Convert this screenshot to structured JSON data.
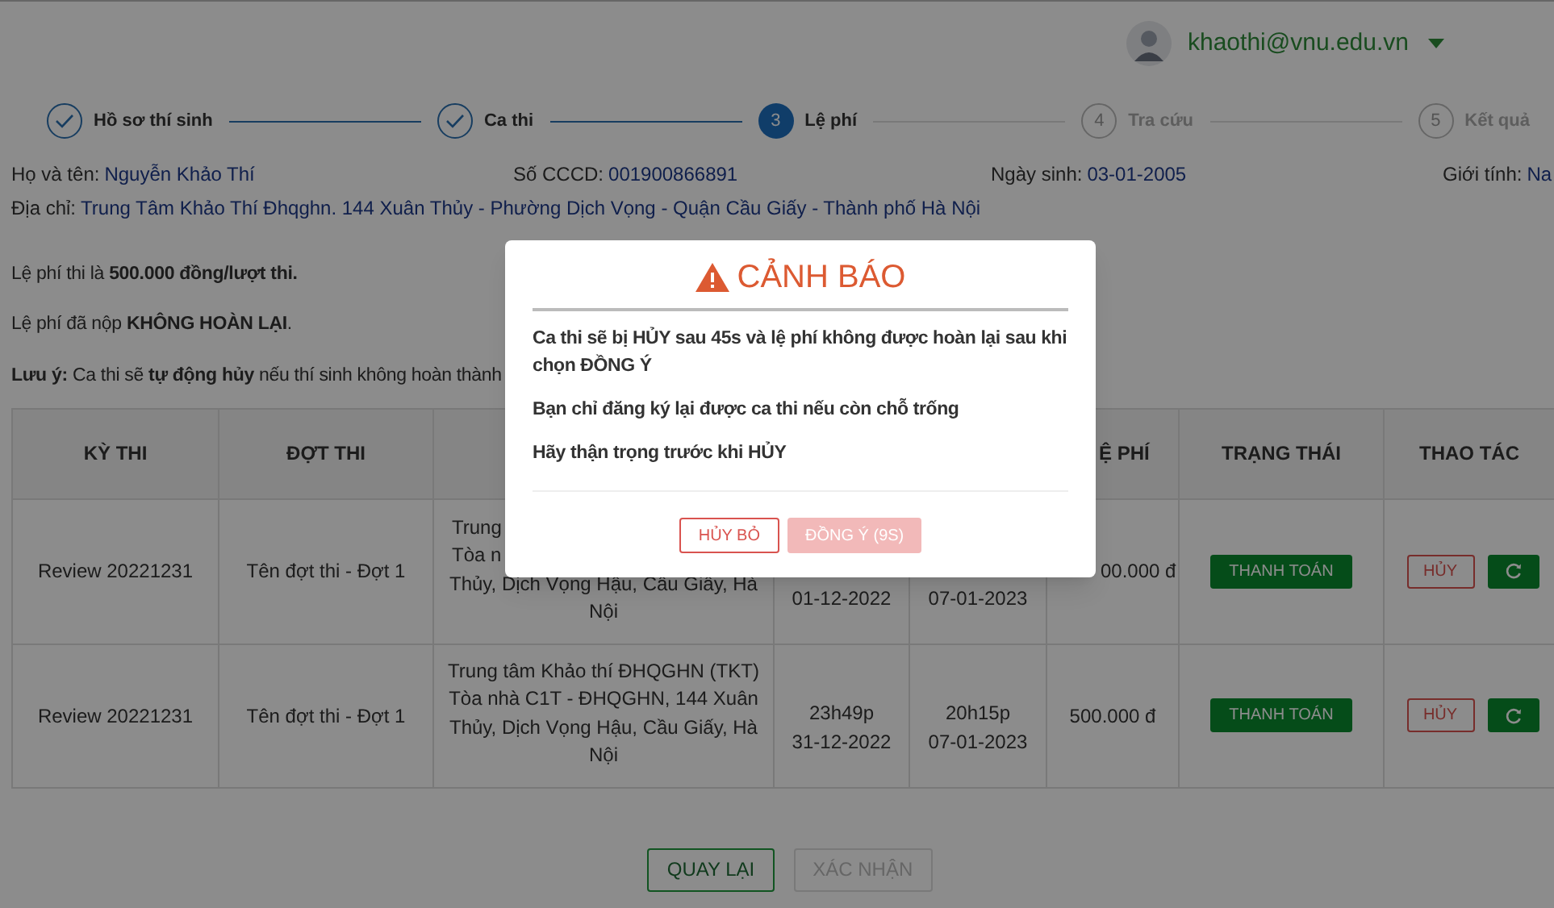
{
  "user": {
    "email": "khaothi@vnu.edu.vn"
  },
  "steps": [
    {
      "label": "Hồ sơ thí sinh",
      "completed": true,
      "selected": false
    },
    {
      "label": "Ca thi",
      "completed": true,
      "selected": false
    },
    {
      "number": "3",
      "label": "Lệ phí",
      "completed": false,
      "selected": true
    },
    {
      "number": "4",
      "label": "Tra cứu",
      "completed": false,
      "selected": false
    },
    {
      "number": "5",
      "label": "Kết quả",
      "completed": false,
      "selected": false
    }
  ],
  "candidate": [
    {
      "label": "Họ và tên:",
      "value": "Nguyễn Khảo Thí"
    },
    {
      "label": "Số CCCD:",
      "value": "001900866891"
    },
    {
      "label": "Ngày sinh:",
      "value": "03-01-2005"
    },
    {
      "label": "Giới tính:",
      "value": "Na"
    }
  ],
  "address": {
    "label": "Địa chỉ:",
    "value": "Trung Tâm Khảo Thí Đhqghn. 144 Xuân Thủy - Phường Dịch Vọng - Quận Cầu Giấy - Thành phố Hà Nội"
  },
  "notes": [
    "Lệ phí thi là **500.000 đồng/lượt thi.**",
    "Lệ phí đã nộp **KHÔNG HOÀN LẠI**.",
    "**Lưu ý:** Ca thi sẽ **tự động hủy** nếu thí sinh không hoàn thành"
  ],
  "table": {
    "columns": [
      {
        "label": "KỲ THI"
      },
      {
        "label": "ĐỢT THI"
      },
      null,
      null,
      null,
      {
        "label": "Ệ PHÍ",
        "cut": true
      },
      {
        "label": "TRẠNG THÁI"
      },
      {
        "label": "THAO TÁC"
      }
    ],
    "rows": [
      {
        "exam": "Review 20221231",
        "round": "Tên đợt thi - Đợt 1",
        "location": [
          {
            "text": "Trung",
            "cut": true
          },
          {
            "text": "Tòa n",
            "cut": true
          },
          {
            "text": "Thủy, Dịch Vọng Hậu, Cầu Giấy, Hà",
            "cut": false
          },
          {
            "text": "Nội",
            "cut": false
          }
        ],
        "start": [
          "01-12-2022"
        ],
        "end": [
          "07-01-2023"
        ],
        "fee": {
          "text": "00.000 đ",
          "cut": true
        },
        "status": "THANH TOÁN",
        "cancel": "HỦY"
      },
      {
        "exam": "Review 20221231",
        "round": "Tên đợt thi - Đợt 1",
        "location": [
          {
            "text": "Trung tâm Khảo thí ĐHQGHN (TKT)",
            "cut": false
          },
          {
            "text": "Tòa nhà C1T - ĐHQGHN, 144 Xuân",
            "cut": false
          },
          {
            "text": "Thủy, Dịch Vọng Hậu, Cầu Giấy, Hà",
            "cut": false
          },
          {
            "text": "Nội",
            "cut": false
          }
        ],
        "start": [
          "23h49p",
          "31-12-2022"
        ],
        "end": [
          "20h15p",
          "07-01-2023"
        ],
        "fee": {
          "text": "500.000 đ",
          "cut": false
        },
        "status": "THANH TOÁN",
        "cancel": "HỦY"
      }
    ]
  },
  "footer_buttons": [
    {
      "label": "QUAY LẠI",
      "disabled": false
    },
    {
      "label": "XÁC NHẬN",
      "disabled": true
    }
  ],
  "dialog": {
    "title": "CẢNH BÁO",
    "paragraphs": [
      "Ca thi sẽ bị HỦY sau 45s và lệ phí không được hoàn lại sau khi chọn ĐỒNG Ý",
      "Bạn chỉ đăng ký lại được ca thi nếu còn chỗ trống",
      "Hãy thận trọng trước khi HỦY"
    ],
    "buttons": [
      {
        "label": "HỦY BỎ",
        "disabled": false
      },
      {
        "label": "ĐỒNG Ý (9S)",
        "disabled": true
      }
    ]
  }
}
